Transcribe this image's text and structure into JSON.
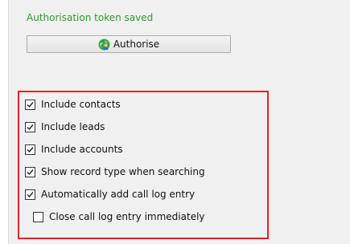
{
  "token_status": {
    "text": "Authorisation token saved",
    "color": "#2a9d2a"
  },
  "authorise_button": {
    "label": "Authorise",
    "icon": "globe-user-icon"
  },
  "options": [
    {
      "label": "Include contacts",
      "checked": true
    },
    {
      "label": "Include leads",
      "checked": true
    },
    {
      "label": "Include accounts",
      "checked": true
    },
    {
      "label": "Show record type when searching",
      "checked": true
    },
    {
      "label": "Automatically add call log entry",
      "checked": true
    },
    {
      "label": "Close call log entry immediately",
      "checked": false
    }
  ],
  "highlight_color": "#e32227"
}
